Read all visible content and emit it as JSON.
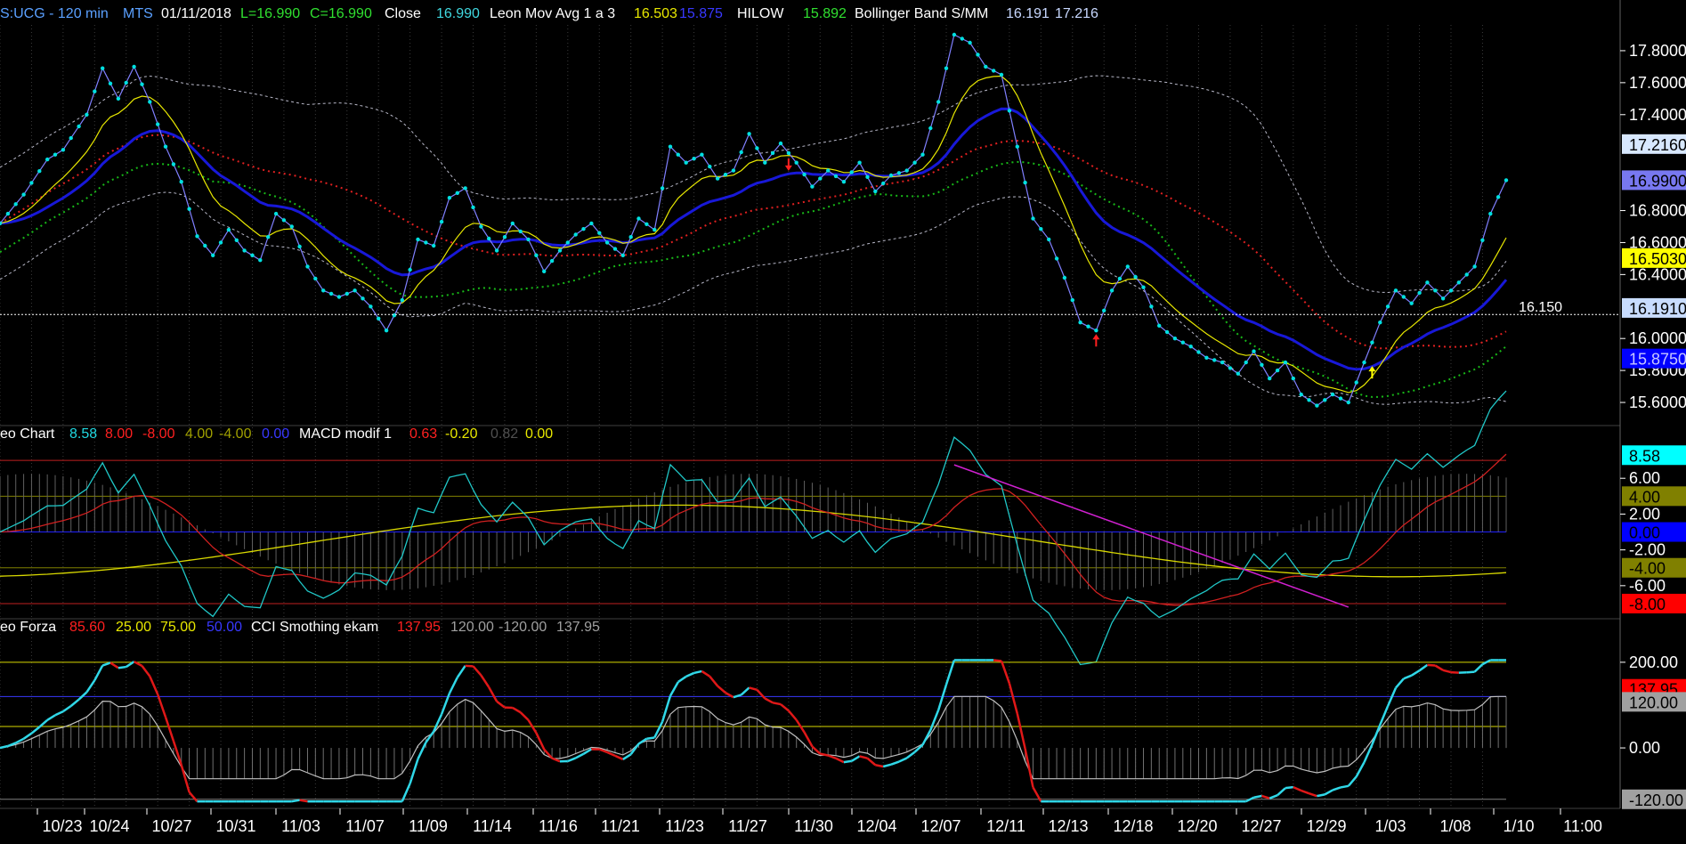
{
  "colors": {
    "background": "#000000",
    "price_line": "#8080ff",
    "price_dots": "#00e0e0",
    "leon_ma_fast": "#e8e800",
    "leon_ma_slow": "#1818d8",
    "hilow": "#18b818",
    "bollinger": "#b8b8c8",
    "bollinger_mid": "#e02020",
    "macd_cyan": "#20c8c8",
    "macd_red": "#d02020",
    "macd_yellow": "#d8d800",
    "macd_trendline": "#d020d0",
    "forza_cyan": "#30d8e8",
    "forza_red": "#e01818",
    "cci_gray": "#c0c0c0",
    "arrow_up_red": "#ff2020",
    "arrow_down_red": "#ff2020",
    "arrow_up_yellow": "#ffff00"
  },
  "header": {
    "symbol": "S:UCG - 120 min",
    "source": "MTS",
    "date": "01/11/2018",
    "low": "L=16.990",
    "close": "C=16.990",
    "close_label": "Close",
    "close_value": "16.990",
    "leon_label": "Leon Mov Avg 1 a 3",
    "leon_v1": "16.503",
    "leon_v2": "15.875",
    "hilow_label": "HILOW",
    "hilow_value": "15.892",
    "boll_label": "Bollinger Band S/MM",
    "boll_v1": "16.191",
    "boll_v2": "17.216"
  },
  "price_axis": {
    "ticks": [
      "17.8000",
      "17.6000",
      "17.4000",
      "16.8000",
      "16.6000",
      "16.4000",
      "16.0000",
      "15.8000",
      "15.6000"
    ],
    "highlighted": [
      {
        "text": "17.2160",
        "bg": "#d8e8ff",
        "fg": "#000000"
      },
      {
        "text": "16.9900",
        "bg": "#7878f0",
        "fg": "#000000"
      },
      {
        "text": "16.5030",
        "bg": "#ffff00",
        "fg": "#000000"
      },
      {
        "text": "16.1910",
        "bg": "#c8dcff",
        "fg": "#000000"
      },
      {
        "text": "15.8750",
        "bg": "#0000ff",
        "fg": "#c8c8ff"
      }
    ],
    "crosshair_value": "16.150"
  },
  "macd_panel": {
    "label": "eo Chart",
    "v1": "8.58",
    "v2": "8.00",
    "v3": "-8.00",
    "v4": "4.00",
    "v5": "-4.00",
    "v6": "0.00",
    "label2": "MACD modif 1",
    "m1": "0.63",
    "m2": "-0.20",
    "m3": "0.82",
    "m4": "0.00",
    "ticks": [
      "6.00",
      "2.00",
      "-2.00",
      "-6.00"
    ],
    "highlighted": [
      {
        "text": "8.58",
        "bg": "#00ffff",
        "fg": "#000000"
      },
      {
        "text": "4.00",
        "bg": "#808000",
        "fg": "#000000"
      },
      {
        "text": "0.00",
        "bg": "#0000ff",
        "fg": "#000000"
      },
      {
        "text": "-4.00",
        "bg": "#808000",
        "fg": "#000000"
      },
      {
        "text": "-8.00",
        "bg": "#ff0000",
        "fg": "#000000"
      }
    ]
  },
  "forza_panel": {
    "label": "eo Forza",
    "v1": "85.60",
    "v2": "25.00",
    "v3": "75.00",
    "v4": "50.00",
    "label2": "CCI Smothing ekam",
    "c1": "137.95",
    "c2": "120.00",
    "c3": "-120.00",
    "c4": "137.95",
    "ticks": [
      "200.00",
      "0.00"
    ],
    "highlighted": [
      {
        "text": "137.95",
        "bg": "#ff0000",
        "fg": "#000000"
      },
      {
        "text": "120.00",
        "bg": "#a0a0a0",
        "fg": "#000000"
      },
      {
        "text": "-120.00",
        "bg": "#a0a0a0",
        "fg": "#000000"
      }
    ]
  },
  "x_axis": {
    "labels": [
      "10/23",
      "10/24",
      "10/27",
      "10/31",
      "11/03",
      "11/07",
      "11/09",
      "11/14",
      "11/16",
      "11/21",
      "11/23",
      "11/27",
      "11/30",
      "12/04",
      "12/07",
      "12/11",
      "12/13",
      "12/18",
      "12/20",
      "12/27",
      "12/29",
      "1/03",
      "1/08",
      "1/10",
      "11:00"
    ]
  },
  "chart_data": {
    "type": "line",
    "x_unit": "bars (120 min)",
    "price": {
      "ylim": [
        15.5,
        17.95
      ],
      "bars": 191,
      "close_series_keypoints": [
        [
          0,
          16.72
        ],
        [
          3,
          16.9
        ],
        [
          6,
          17.12
        ],
        [
          8,
          17.18
        ],
        [
          11,
          17.4
        ],
        [
          13,
          17.69
        ],
        [
          15,
          17.5
        ],
        [
          17,
          17.7
        ],
        [
          19,
          17.48
        ],
        [
          21,
          17.2
        ],
        [
          23,
          16.98
        ],
        [
          25,
          16.64
        ],
        [
          27,
          16.52
        ],
        [
          29,
          16.68
        ],
        [
          31,
          16.55
        ],
        [
          33,
          16.49
        ],
        [
          35,
          16.78
        ],
        [
          37,
          16.7
        ],
        [
          39,
          16.45
        ],
        [
          41,
          16.3
        ],
        [
          43,
          16.26
        ],
        [
          45,
          16.3
        ],
        [
          47,
          16.2
        ],
        [
          49,
          16.05
        ],
        [
          51,
          16.24
        ],
        [
          53,
          16.62
        ],
        [
          55,
          16.58
        ],
        [
          57,
          16.88
        ],
        [
          59,
          16.94
        ],
        [
          61,
          16.7
        ],
        [
          63,
          16.55
        ],
        [
          65,
          16.72
        ],
        [
          67,
          16.62
        ],
        [
          69,
          16.42
        ],
        [
          71,
          16.55
        ],
        [
          73,
          16.65
        ],
        [
          75,
          16.72
        ],
        [
          77,
          16.6
        ],
        [
          79,
          16.52
        ],
        [
          81,
          16.75
        ],
        [
          83,
          16.68
        ],
        [
          85,
          17.2
        ],
        [
          87,
          17.1
        ],
        [
          89,
          17.15
        ],
        [
          91,
          17.0
        ],
        [
          93,
          17.05
        ],
        [
          95,
          17.28
        ],
        [
          97,
          17.1
        ],
        [
          99,
          17.22
        ],
        [
          101,
          17.1
        ],
        [
          103,
          16.95
        ],
        [
          105,
          17.05
        ],
        [
          107,
          16.98
        ],
        [
          109,
          17.1
        ],
        [
          111,
          16.92
        ],
        [
          113,
          17.02
        ],
        [
          115,
          17.05
        ],
        [
          117,
          17.15
        ],
        [
          119,
          17.48
        ],
        [
          121,
          17.9
        ],
        [
          123,
          17.85
        ],
        [
          125,
          17.7
        ],
        [
          127,
          17.65
        ],
        [
          129,
          17.2
        ],
        [
          131,
          16.75
        ],
        [
          133,
          16.62
        ],
        [
          135,
          16.38
        ],
        [
          137,
          16.1
        ],
        [
          139,
          16.05
        ],
        [
          141,
          16.3
        ],
        [
          143,
          16.45
        ],
        [
          145,
          16.32
        ],
        [
          147,
          16.08
        ],
        [
          149,
          16.0
        ],
        [
          151,
          15.95
        ],
        [
          153,
          15.88
        ],
        [
          155,
          15.85
        ],
        [
          157,
          15.78
        ],
        [
          159,
          15.92
        ],
        [
          161,
          15.75
        ],
        [
          163,
          15.85
        ],
        [
          165,
          15.65
        ],
        [
          167,
          15.58
        ],
        [
          169,
          15.65
        ],
        [
          171,
          15.6
        ],
        [
          173,
          15.85
        ],
        [
          175,
          16.1
        ],
        [
          177,
          16.3
        ],
        [
          179,
          16.22
        ],
        [
          181,
          16.35
        ],
        [
          183,
          16.25
        ],
        [
          185,
          16.35
        ],
        [
          187,
          16.45
        ],
        [
          189,
          16.78
        ],
        [
          191,
          16.99
        ]
      ],
      "last_close": 16.99,
      "leon_ma_fast_last": 16.503,
      "leon_ma_slow_last": 15.875,
      "hilow_last": 15.892,
      "bollinger_lower_last": 16.191,
      "bollinger_upper_last": 17.216,
      "crosshair": 16.15
    },
    "macd": {
      "ylim": [
        -9,
        10
      ],
      "levels": [
        8,
        4,
        0,
        -4,
        -8
      ],
      "last": 8.58
    },
    "forza": {
      "ylim": [
        -135,
        260
      ],
      "levels": [
        200,
        120,
        50,
        0,
        -120
      ],
      "last_cci": 137.95
    }
  }
}
